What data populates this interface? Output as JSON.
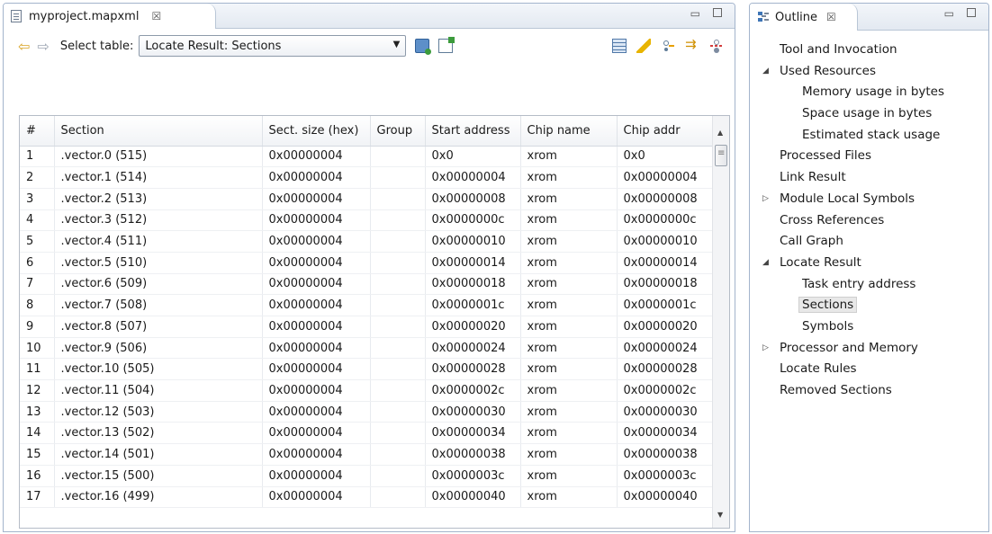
{
  "editor": {
    "tab_title": "myproject.mapxml",
    "tab_close": "☒",
    "min_glyph": "▭",
    "toolbar": {
      "back_glyph": "⇦",
      "forward_glyph": "⇨",
      "select_label": "Select table:",
      "select_value": "Locate Result: Sections",
      "select_arrow": "▼"
    }
  },
  "table": {
    "columns": [
      "#",
      "Section",
      "Sect. size (hex)",
      "Group",
      "Start address",
      "Chip name",
      "Chip addr"
    ],
    "rows": [
      [
        "1",
        ".vector.0 (515)",
        "0x00000004",
        "",
        "0x0",
        "xrom",
        "0x0"
      ],
      [
        "2",
        ".vector.1 (514)",
        "0x00000004",
        "",
        "0x00000004",
        "xrom",
        "0x00000004"
      ],
      [
        "3",
        ".vector.2 (513)",
        "0x00000004",
        "",
        "0x00000008",
        "xrom",
        "0x00000008"
      ],
      [
        "4",
        ".vector.3 (512)",
        "0x00000004",
        "",
        "0x0000000c",
        "xrom",
        "0x0000000c"
      ],
      [
        "5",
        ".vector.4 (511)",
        "0x00000004",
        "",
        "0x00000010",
        "xrom",
        "0x00000010"
      ],
      [
        "6",
        ".vector.5 (510)",
        "0x00000004",
        "",
        "0x00000014",
        "xrom",
        "0x00000014"
      ],
      [
        "7",
        ".vector.6 (509)",
        "0x00000004",
        "",
        "0x00000018",
        "xrom",
        "0x00000018"
      ],
      [
        "8",
        ".vector.7 (508)",
        "0x00000004",
        "",
        "0x0000001c",
        "xrom",
        "0x0000001c"
      ],
      [
        "9",
        ".vector.8 (507)",
        "0x00000004",
        "",
        "0x00000020",
        "xrom",
        "0x00000020"
      ],
      [
        "10",
        ".vector.9 (506)",
        "0x00000004",
        "",
        "0x00000024",
        "xrom",
        "0x00000024"
      ],
      [
        "11",
        ".vector.10 (505)",
        "0x00000004",
        "",
        "0x00000028",
        "xrom",
        "0x00000028"
      ],
      [
        "12",
        ".vector.11 (504)",
        "0x00000004",
        "",
        "0x0000002c",
        "xrom",
        "0x0000002c"
      ],
      [
        "13",
        ".vector.12 (503)",
        "0x00000004",
        "",
        "0x00000030",
        "xrom",
        "0x00000030"
      ],
      [
        "14",
        ".vector.13 (502)",
        "0x00000004",
        "",
        "0x00000034",
        "xrom",
        "0x00000034"
      ],
      [
        "15",
        ".vector.14 (501)",
        "0x00000004",
        "",
        "0x00000038",
        "xrom",
        "0x00000038"
      ],
      [
        "16",
        ".vector.15 (500)",
        "0x00000004",
        "",
        "0x0000003c",
        "xrom",
        "0x0000003c"
      ],
      [
        "17",
        ".vector.16 (499)",
        "0x00000004",
        "",
        "0x00000040",
        "xrom",
        "0x00000040"
      ]
    ]
  },
  "outline": {
    "tab_title": "Outline",
    "tab_close": "☒",
    "items": [
      {
        "label": "Tool and Invocation",
        "level": 0,
        "toggle": ""
      },
      {
        "label": "Used Resources",
        "level": 0,
        "toggle": "◢"
      },
      {
        "label": "Memory usage in bytes",
        "level": 1,
        "toggle": ""
      },
      {
        "label": "Space usage in bytes",
        "level": 1,
        "toggle": ""
      },
      {
        "label": "Estimated stack usage",
        "level": 1,
        "toggle": ""
      },
      {
        "label": "Processed Files",
        "level": 0,
        "toggle": ""
      },
      {
        "label": "Link Result",
        "level": 0,
        "toggle": ""
      },
      {
        "label": "Module Local Symbols",
        "level": 0,
        "toggle": "▷"
      },
      {
        "label": "Cross References",
        "level": 0,
        "toggle": ""
      },
      {
        "label": "Call Graph",
        "level": 0,
        "toggle": ""
      },
      {
        "label": "Locate Result",
        "level": 0,
        "toggle": "◢"
      },
      {
        "label": "Task entry address",
        "level": 1,
        "toggle": ""
      },
      {
        "label": "Sections",
        "level": 1,
        "toggle": "",
        "selected": true
      },
      {
        "label": "Symbols",
        "level": 1,
        "toggle": ""
      },
      {
        "label": "Processor and Memory",
        "level": 0,
        "toggle": "▷"
      },
      {
        "label": "Locate Rules",
        "level": 0,
        "toggle": ""
      },
      {
        "label": "Removed Sections",
        "level": 0,
        "toggle": ""
      }
    ]
  },
  "icons": {
    "back": "back-arrow-icon",
    "forward": "forward-arrow-icon",
    "export": "export-table-icon",
    "import": "import-table-icon",
    "table_view": "table-view-icon",
    "highlight": "highlight-brush-icon",
    "tree": "tree-view-icon",
    "merge": "merge-arrows-icon",
    "split": "split-icon"
  }
}
